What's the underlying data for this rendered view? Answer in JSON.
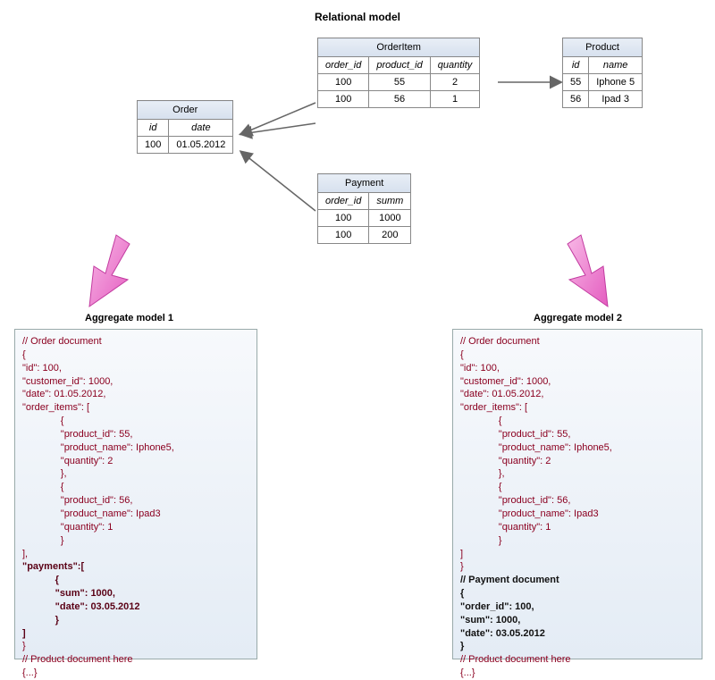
{
  "title": "Relational model",
  "tables": {
    "order": {
      "name": "Order",
      "cols": [
        "id",
        "date"
      ],
      "rows": [
        [
          "100",
          "01.05.2012"
        ]
      ]
    },
    "orderitem": {
      "name": "OrderItem",
      "cols": [
        "order_id",
        "product_id",
        "quantity"
      ],
      "rows": [
        [
          "100",
          "55",
          "2"
        ],
        [
          "100",
          "56",
          "1"
        ]
      ]
    },
    "product": {
      "name": "Product",
      "cols": [
        "id",
        "name"
      ],
      "rows": [
        [
          "55",
          "Iphone 5"
        ],
        [
          "56",
          "Ipad 3"
        ]
      ]
    },
    "payment": {
      "name": "Payment",
      "cols": [
        "order_id",
        "summ"
      ],
      "rows": [
        [
          "100",
          "1000"
        ],
        [
          "100",
          "200"
        ]
      ]
    }
  },
  "aggregates": {
    "label1": "Aggregate model 1",
    "label2": "Aggregate model 2",
    "doc1": {
      "l1": "// Order document",
      "l2": "{",
      "l3": "\"id\": 100,",
      "l4": "\"customer_id\": 1000,",
      "l5": "\"date\": 01.05.2012,",
      "l6": "\"order_items\": [",
      "l7": "              {",
      "l8": "              \"product_id\": 55,",
      "l9": "              \"product_name\": Iphone5,",
      "l10": "              \"quantity\": 2",
      "l11": "              },",
      "l12": "              {",
      "l13": "              \"product_id\": 56,",
      "l14": "              \"product_name\": Ipad3",
      "l15": "              \"quantity\": 1",
      "l16": "              }",
      "l17": "],",
      "l18": "\"payments\":[",
      "l19": "            {",
      "l20": "            \"sum\": 1000,",
      "l21": "            \"date\": 03.05.2012",
      "l22": "            }",
      "l23": "]",
      "l24": "}",
      "l25": "// Product document here",
      "l26": "{...}"
    },
    "doc2": {
      "l1": "// Order document",
      "l2": "{",
      "l3": "\"id\": 100,",
      "l4": "\"customer_id\": 1000,",
      "l5": "\"date\": 01.05.2012,",
      "l6": "\"order_items\": [",
      "l7": "              {",
      "l8": "              \"product_id\": 55,",
      "l9": "              \"product_name\": Iphone5,",
      "l10": "              \"quantity\": 2",
      "l11": "              },",
      "l12": "              {",
      "l13": "              \"product_id\": 56,",
      "l14": "              \"product_name\": Ipad3",
      "l15": "              \"quantity\": 1",
      "l16": "              }",
      "l17": "]",
      "l18": "}",
      "l19": "// Payment document",
      "l20": "{",
      "l21": "\"order_id\": 100,",
      "l22": "\"sum\": 1000,",
      "l23": "\"date\": 03.05.2012",
      "l24": "}",
      "l25": "// Product document here",
      "l26": "{...}"
    }
  }
}
